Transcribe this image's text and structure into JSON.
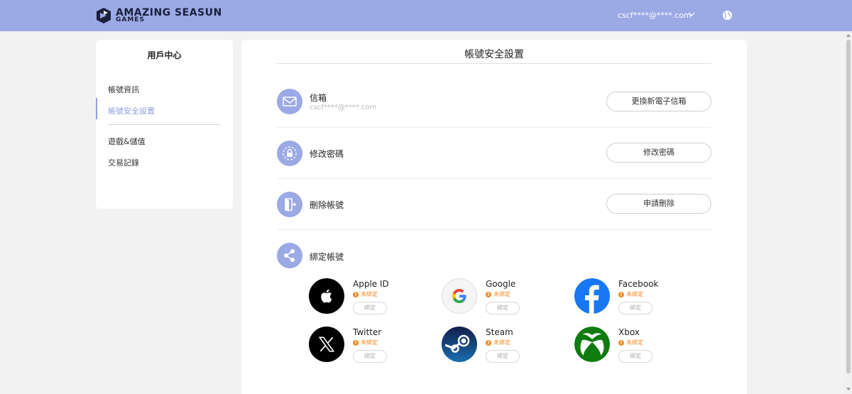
{
  "header": {
    "logo_line1": "AMAZING SEASUN",
    "logo_line2": "GAMES",
    "user_email": "cscf****@****.com",
    "icons": {
      "chevron": "chevron-down-icon",
      "language": "globe-icon"
    },
    "bg_color": "#9ba9e4"
  },
  "sidebar": {
    "title": "用戶中心",
    "items": [
      {
        "label": "帳號資訊",
        "active": false
      },
      {
        "label": "帳號安全設置",
        "active": true
      },
      {
        "label": "遊戲&儲值",
        "active": false
      },
      {
        "label": "交易記錄",
        "active": false
      }
    ],
    "active_color": "#8fa0de"
  },
  "main": {
    "title": "帳號安全設置",
    "rows": [
      {
        "icon": "mail-icon",
        "label": "信箱",
        "sub": "cscf****@****.com",
        "button": "更換新電子信箱"
      },
      {
        "icon": "lock-icon",
        "label": "修改密碼",
        "button": "修改密碼"
      },
      {
        "icon": "exit-door-icon",
        "label": "刪除帳號",
        "button": "申請刪除"
      },
      {
        "icon": "share-icon",
        "label": "綁定帳號"
      }
    ],
    "social": [
      {
        "name": "Apple ID",
        "status": "未綁定",
        "button": "綁定",
        "icon": "apple-icon"
      },
      {
        "name": "Google",
        "status": "未綁定",
        "button": "綁定",
        "icon": "google-icon"
      },
      {
        "name": "Facebook",
        "status": "未綁定",
        "button": "綁定",
        "icon": "facebook-icon"
      },
      {
        "name": "Twitter",
        "status": "未綁定",
        "button": "綁定",
        "icon": "x-twitter-icon"
      },
      {
        "name": "Steam",
        "status": "未綁定",
        "button": "綁定",
        "icon": "steam-icon"
      },
      {
        "name": "Xbox",
        "status": "未綁定",
        "button": "綁定",
        "icon": "xbox-icon"
      }
    ],
    "warn_glyph": "!",
    "status_color": "#f08a24"
  }
}
